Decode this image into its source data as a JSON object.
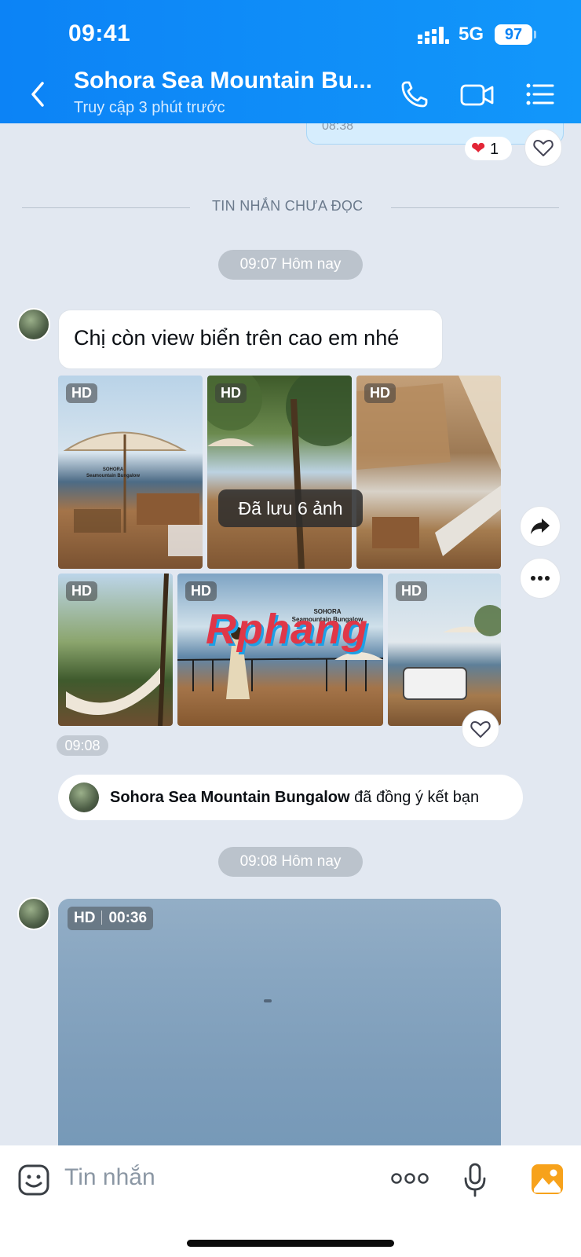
{
  "status": {
    "time": "09:41",
    "network": "5G",
    "battery": "97"
  },
  "header": {
    "title": "Sohora Sea Mountain Bu...",
    "subtitle": "Truy cập 3 phút trước"
  },
  "previous": {
    "time": "08:38",
    "reaction_count": "1"
  },
  "divider": {
    "label": "TIN NHẮN CHƯA ĐỌC"
  },
  "chips": {
    "first": "09:07 Hôm nay",
    "second": "09:08 Hôm nay"
  },
  "message": {
    "text": "Chị còn view biển trên cao em nhé"
  },
  "photos": {
    "badge": "HD",
    "toast": "Đã lưu 6 ảnh",
    "time": "09:08",
    "brand_line1": "SOHORA",
    "brand_line2": "Seamountain Bungalow",
    "watermark": "Rphang"
  },
  "friend": {
    "name": "Sohora Sea Mountain Bungalow",
    "action": " đã đồng ý kết bạn"
  },
  "video": {
    "badge": "HD",
    "duration": "00:36"
  },
  "input": {
    "placeholder": "Tin nhắn"
  },
  "colors": {
    "header": "#0c83f6",
    "background": "#e2e8f1",
    "heart": "#e32636"
  }
}
